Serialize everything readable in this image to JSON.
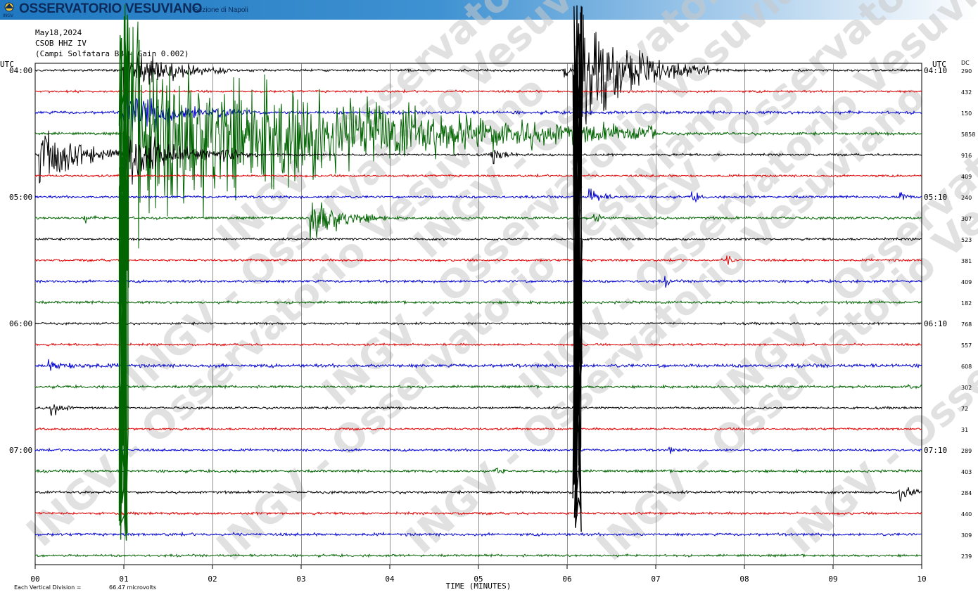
{
  "header": {
    "brand": "OSSERVATORIO VESUVIANO",
    "section": "Sezione di Napoli",
    "logo_text": "INGV"
  },
  "meta": {
    "date": "May18,2024",
    "station": "CSOB HHZ IV",
    "desc": "(Campi Solfatara BB - Gain 0.002)"
  },
  "watermark": "INGV - Osservatorio Vesuviano",
  "colors": {
    "black": "#000000",
    "red": "#e00000",
    "blue": "#0000d0",
    "green": "#006400",
    "grid": "#000000"
  },
  "chart_data": {
    "type": "line",
    "subtype": "helicorder",
    "xlabel": "TIME (MINUTES)",
    "x_ticks": [
      "00",
      "01",
      "02",
      "03",
      "04",
      "05",
      "06",
      "07",
      "08",
      "09",
      "10"
    ],
    "xlim": [
      0,
      10
    ],
    "left_axis_label": "UTC",
    "right_axis_label": "UTC",
    "dc_label": "DC",
    "left_time_labels": [
      {
        "row": 0,
        "text": "04:00"
      },
      {
        "row": 6,
        "text": "05:00"
      },
      {
        "row": 12,
        "text": "06:00"
      },
      {
        "row": 18,
        "text": "07:00"
      }
    ],
    "right_time_labels": [
      {
        "row": 0,
        "text": "04:10"
      },
      {
        "row": 6,
        "text": "05:10"
      },
      {
        "row": 12,
        "text": "06:10"
      },
      {
        "row": 18,
        "text": "07:10"
      }
    ],
    "color_cycle": [
      "black",
      "red",
      "blue",
      "green"
    ],
    "dc_values": [
      "290",
      "432",
      "150",
      "5858",
      "916",
      "409",
      "240",
      "307",
      "523",
      "381",
      "409",
      "182",
      "768",
      "557",
      "608",
      "302",
      "72",
      "31",
      "289",
      "403",
      "284",
      "440",
      "309",
      "239"
    ],
    "noise": [
      1.2,
      1.1,
      1.5,
      1.4,
      1.1,
      1.1,
      1.2,
      1.3,
      1.1,
      1.2,
      1.3,
      1.3,
      1.1,
      1.1,
      1.7,
      1.3,
      1.1,
      1.1,
      1.2,
      1.3,
      1.3,
      1.2,
      1.4,
      1.2
    ],
    "events": [
      {
        "row": 0,
        "minute": 6.1,
        "amp": 80,
        "dur": 0.5
      },
      {
        "row": 0,
        "minute": 5.97,
        "amp": 10,
        "dur": 0.05
      },
      {
        "row": 0,
        "minute": 1.0,
        "amp": 30,
        "dur": 0.4
      },
      {
        "row": 2,
        "minute": 1.0,
        "amp": 30,
        "dur": 0.5
      },
      {
        "row": 3,
        "minute": 1.0,
        "amp": 120,
        "dur": 2.0
      },
      {
        "row": 3,
        "minute": 2.78,
        "amp": 16,
        "dur": 0.12
      },
      {
        "row": 3,
        "minute": 4.17,
        "amp": 14,
        "dur": 0.1
      },
      {
        "row": 3,
        "minute": 6.85,
        "amp": 8,
        "dur": 0.08
      },
      {
        "row": 3,
        "minute": 3.1,
        "amp": 5,
        "dur": 0.08
      },
      {
        "row": 3,
        "minute": 4.9,
        "amp": 5,
        "dur": 0.05
      },
      {
        "row": 4,
        "minute": 0.05,
        "amp": 40,
        "dur": 0.4
      },
      {
        "row": 4,
        "minute": 2.12,
        "amp": 10,
        "dur": 0.1
      },
      {
        "row": 4,
        "minute": 5.15,
        "amp": 10,
        "dur": 0.1
      },
      {
        "row": 4,
        "minute": 1.0,
        "amp": 30,
        "dur": 0.5
      },
      {
        "row": 6,
        "minute": 6.24,
        "amp": 12,
        "dur": 0.1
      },
      {
        "row": 6,
        "minute": 7.4,
        "amp": 8,
        "dur": 0.06
      },
      {
        "row": 6,
        "minute": 9.75,
        "amp": 6,
        "dur": 0.06
      },
      {
        "row": 7,
        "minute": 3.1,
        "amp": 30,
        "dur": 0.3
      },
      {
        "row": 7,
        "minute": 0.55,
        "amp": 5,
        "dur": 0.05
      },
      {
        "row": 7,
        "minute": 6.3,
        "amp": 6,
        "dur": 0.06
      },
      {
        "row": 9,
        "minute": 7.8,
        "amp": 6,
        "dur": 0.05
      },
      {
        "row": 10,
        "minute": 7.1,
        "amp": 5,
        "dur": 0.05
      },
      {
        "row": 14,
        "minute": 0.15,
        "amp": 4,
        "dur": 0.3
      },
      {
        "row": 15,
        "minute": 9.85,
        "amp": 5,
        "dur": 0.05
      },
      {
        "row": 16,
        "minute": 0.17,
        "amp": 12,
        "dur": 0.1
      },
      {
        "row": 18,
        "minute": 7.15,
        "amp": 4,
        "dur": 0.05
      },
      {
        "row": 19,
        "minute": 5.2,
        "amp": 6,
        "dur": 0.05
      },
      {
        "row": 20,
        "minute": 9.75,
        "amp": 16,
        "dur": 0.1
      }
    ],
    "spikes": [
      {
        "minute": 1.0,
        "top_row": 0,
        "bottom_row": 23,
        "color": "green",
        "amp": 0.95
      },
      {
        "minute": 6.12,
        "top_row": 0,
        "bottom_row": 22,
        "color": "black",
        "amp": 1.0
      }
    ],
    "scale_note": "Each Vertical Division =",
    "scale_value": "66.47 microvolts"
  }
}
